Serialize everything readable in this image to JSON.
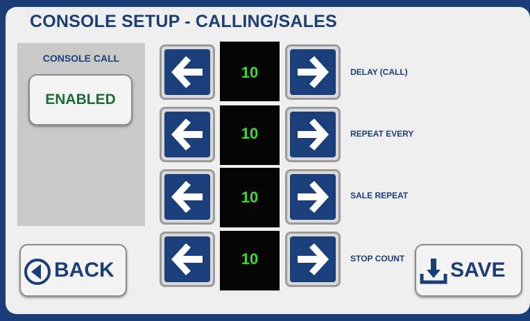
{
  "title": "CONSOLE SETUP - CALLING/SALES",
  "console_call": {
    "label": "CONSOLE CALL",
    "button_label": "ENABLED"
  },
  "settings": [
    {
      "label": "DELAY (CALL)",
      "value": "10"
    },
    {
      "label": "REPEAT EVERY",
      "value": "10"
    },
    {
      "label": "SALE REPEAT",
      "value": "10"
    },
    {
      "label": "STOP COUNT",
      "value": "10"
    }
  ],
  "back_label": "BACK",
  "save_label": "SAVE",
  "icons": {
    "decrement": "arrow-left-icon",
    "increment": "arrow-right-icon",
    "back": "circle-left-arrow-icon",
    "save": "download-icon"
  },
  "colors": {
    "frame": "#1b3d78",
    "panel": "#efefef",
    "arrow_button": "#1b3f7a",
    "value_text": "#3bdc2a",
    "enabled_text": "#1e6b3a"
  }
}
